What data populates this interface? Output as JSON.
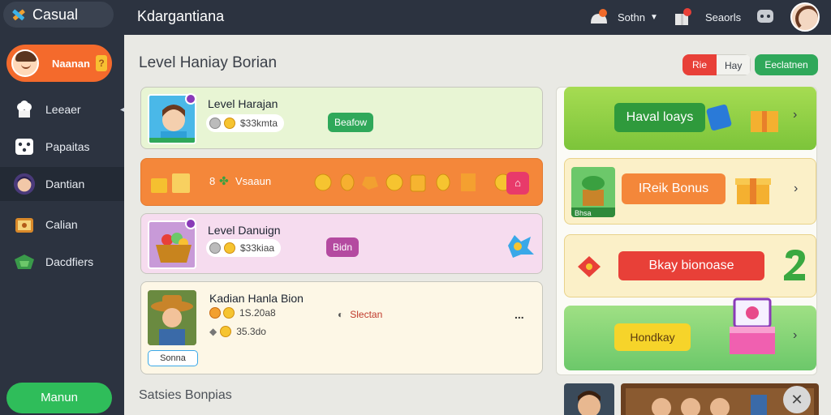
{
  "app": {
    "brand": "Casual",
    "page_title": "Kdargantiana"
  },
  "sidebar": {
    "profile_name": "Naanan",
    "profile_badge": "?",
    "items": [
      {
        "label": "Leeaer",
        "icon": "chef-hat-icon"
      },
      {
        "label": "Papaitas",
        "icon": "dice-icon"
      },
      {
        "label": "Dantian",
        "icon": "avatar-icon"
      },
      {
        "label": "Calian",
        "icon": "treasure-box-icon"
      },
      {
        "label": "Dacdfiers",
        "icon": "gift-icon"
      }
    ],
    "main_button": "Manun"
  },
  "topbar": {
    "item1": "Sothn",
    "item2": "Seaorls"
  },
  "main": {
    "section_title": "Level Haniay Borian",
    "segment": {
      "a": "Rie",
      "b": "Hay"
    },
    "green_button": "Eeclatnen",
    "section2_title": "Satsies Bonpias",
    "cards": [
      {
        "title": "Level Harajan",
        "stat": "$33kmta",
        "action": "Beafow"
      },
      {
        "currency": "8",
        "code": "Vsaaun"
      },
      {
        "title": "Level Danuign",
        "stat": "$33kiaa",
        "action": "Bidn"
      },
      {
        "title": "Kadian Hanla Bion",
        "stat1": "1S.20a8",
        "stat2": "35.3do",
        "tag": "Slectan",
        "label": "Sonna",
        "more": "..."
      }
    ],
    "right_cards": [
      {
        "label": "Haval loays"
      },
      {
        "label": "IReik Bonus",
        "thumb_label": "Bhsa"
      },
      {
        "label": "Bkay bionoase"
      },
      {
        "label": "Hondkay"
      }
    ]
  },
  "colors": {
    "sidebar": "#2c3340",
    "accent_orange": "#f46a2c",
    "accent_green": "#2fbd5a",
    "card_green": "#e8f5d4",
    "card_orange": "#f4873a",
    "card_pink": "#f6dcef",
    "card_cream": "#fdf7e6"
  }
}
